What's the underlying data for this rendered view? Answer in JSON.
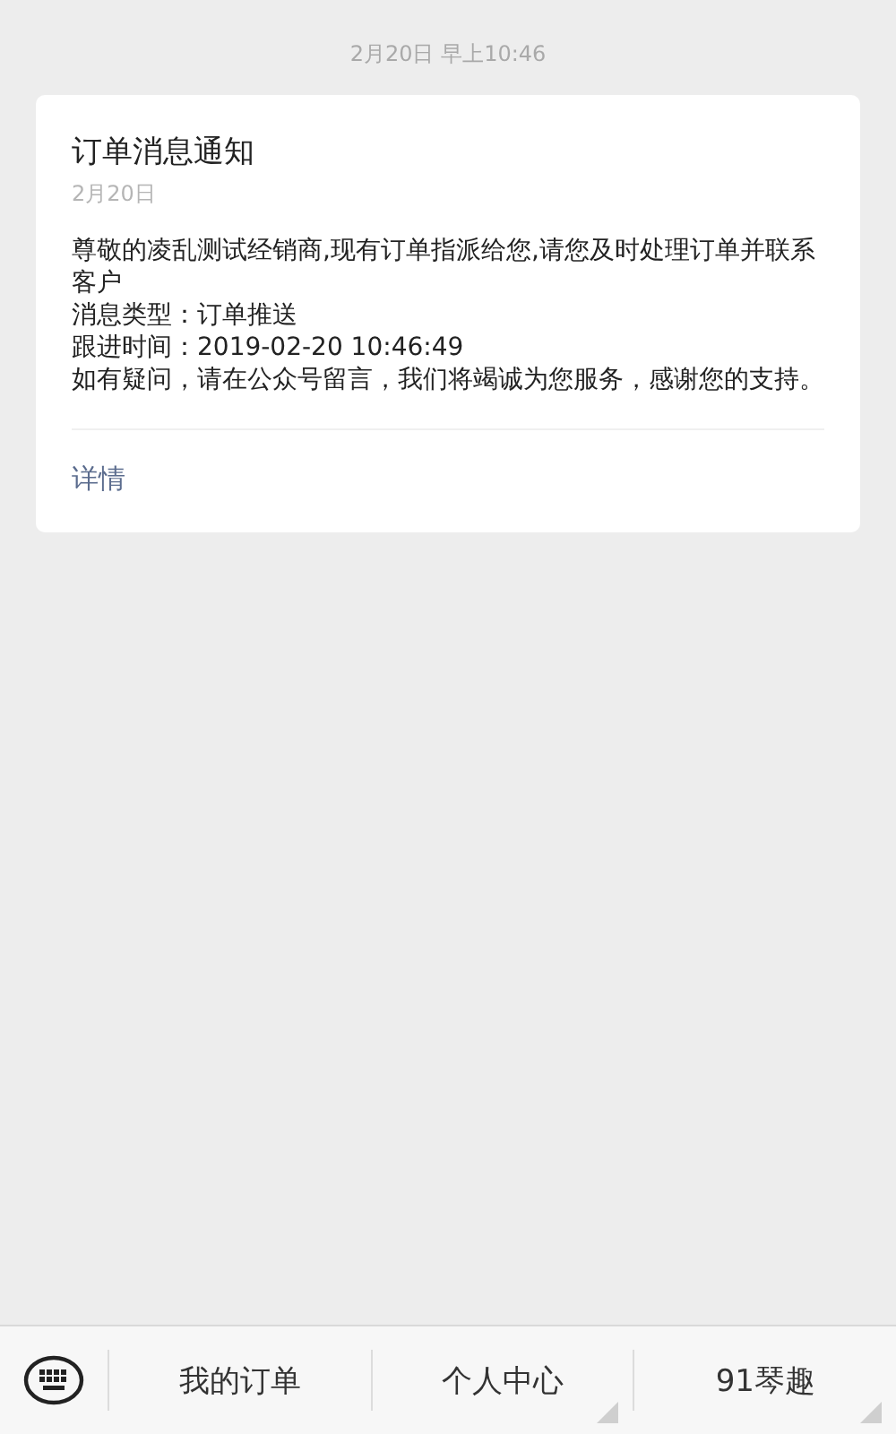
{
  "timestamp": "2月20日 早上10:46",
  "card": {
    "title": "订单消息通知",
    "date": "2月20日",
    "body": [
      "尊敬的凌乱测试经销商,现有订单指派给您,请您及时处理订单并联系客户",
      "消息类型：订单推送",
      "跟进时间：2019-02-20 10:46:49",
      "如有疑问，请在公众号留言，我们将竭诚为您服务，感谢您的支持。"
    ],
    "link": "详情"
  },
  "menu": [
    {
      "label": "我的订单",
      "has_submenu": false
    },
    {
      "label": "个人中心",
      "has_submenu": true
    },
    {
      "label": "91琴趣",
      "has_submenu": true
    }
  ]
}
